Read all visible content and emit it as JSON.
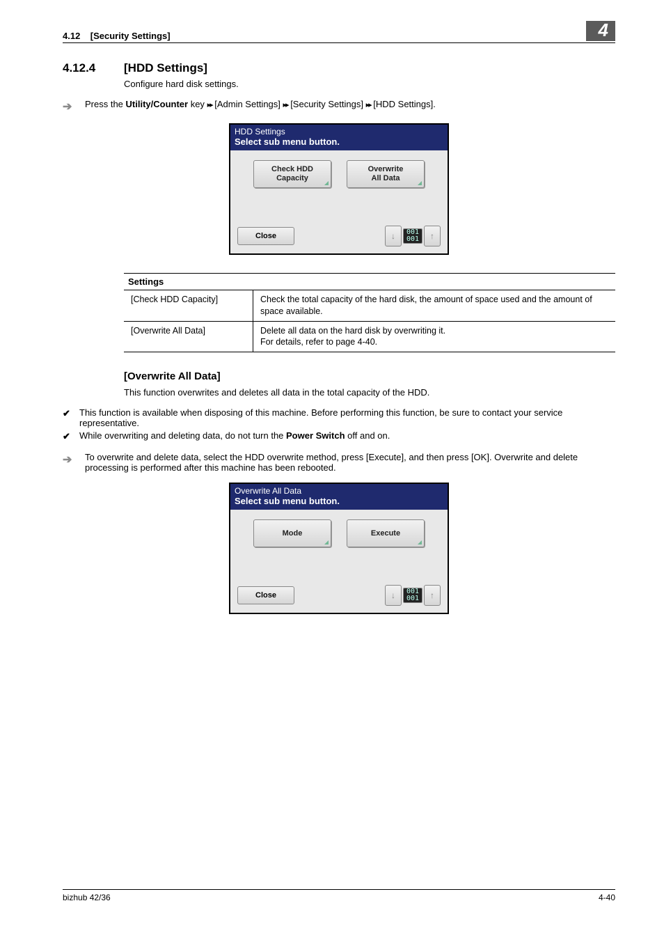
{
  "header": {
    "sec": "4.12",
    "title": "[Security Settings]",
    "chapter": "4"
  },
  "section": {
    "num": "4.12.4",
    "title": "[HDD Settings]",
    "intro": "Configure hard disk settings."
  },
  "breadcrumb": {
    "prefix": "Press the ",
    "key": "Utility/Counter",
    "rest": " key ",
    "p1": "[Admin Settings]",
    "p2": "[Security Settings]",
    "p3": "[HDD Settings]."
  },
  "lcd1": {
    "title": "HDD Settings",
    "subtitle": "Select sub menu button.",
    "btn1_l1": "Check HDD",
    "btn1_l2": "Capacity",
    "btn2_l1": "Overwrite",
    "btn2_l2": "All Data",
    "close": "Close",
    "ctr_top": "001",
    "ctr_bot": "001"
  },
  "table": {
    "header": "Settings",
    "r1k": "[Check HDD Capacity]",
    "r1v": "Check the total capacity of the hard disk, the amount of space used and the amount of space available.",
    "r2k": "[Overwrite All Data]",
    "r2v": "Delete all data on the hard disk by overwriting it.\nFor details, refer to page 4-40."
  },
  "overwrite": {
    "title": "[Overwrite All Data]",
    "intro": "This function overwrites and deletes all data in the total capacity of the HDD.",
    "check1": "This function is available when disposing of this machine. Before performing this function, be sure to contact your service representative.",
    "check2a": "While overwriting and deleting data, do not turn the ",
    "check2b": "Power Switch",
    "check2c": " off and on.",
    "step": "To overwrite and delete data, select the HDD overwrite method, press [Execute], and then press [OK]. Overwrite and delete processing is performed after this machine has been rebooted."
  },
  "lcd2": {
    "title": "Overwrite All Data",
    "subtitle": "Select sub menu button.",
    "btn1": "Mode",
    "btn2": "Execute",
    "close": "Close",
    "ctr_top": "001",
    "ctr_bot": "001"
  },
  "footer": {
    "left": "bizhub 42/36",
    "right": "4-40"
  },
  "glyphs": {
    "dbl": "▸▸"
  }
}
